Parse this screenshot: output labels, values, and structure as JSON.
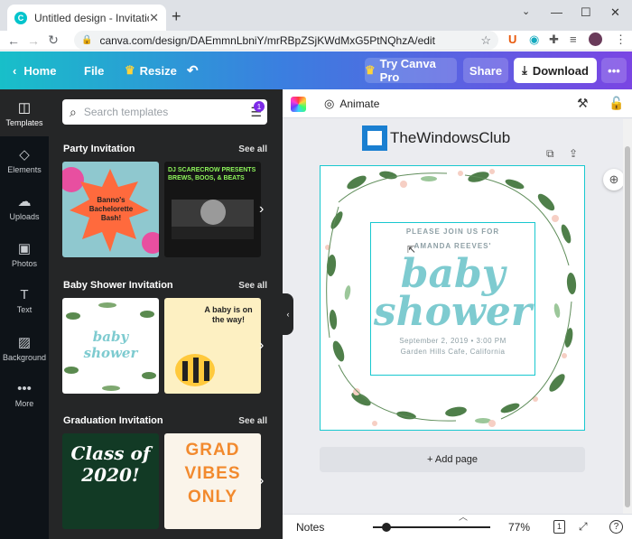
{
  "browser": {
    "tab_title": "Untitled design - Invitation (Squ…",
    "tab_favicon": "C",
    "url": "canva.com/design/DAEmmnLbniY/mrRBpZSjKWdMxG5PtNQhzA/edit"
  },
  "header": {
    "home": "Home",
    "file": "File",
    "resize": "Resize",
    "try_pro": "Try Canva Pro",
    "share": "Share",
    "download": "Download"
  },
  "rail": [
    {
      "label": "Templates",
      "icon": "templates-icon"
    },
    {
      "label": "Elements",
      "icon": "elements-icon"
    },
    {
      "label": "Uploads",
      "icon": "uploads-icon"
    },
    {
      "label": "Photos",
      "icon": "photos-icon"
    },
    {
      "label": "Text",
      "icon": "text-icon"
    },
    {
      "label": "Background",
      "icon": "background-icon"
    },
    {
      "label": "More",
      "icon": "more-icon"
    }
  ],
  "panel": {
    "search_placeholder": "Search templates",
    "filter_badge": "1",
    "see_all": "See all",
    "sections": [
      {
        "title": "Party Invitation",
        "thumbs": [
          {
            "text": "Banno's Bachelorette Bash!"
          },
          {
            "text": "DJ SCARECROW PRESENTS BREWS, BOOS, & BEATS"
          }
        ]
      },
      {
        "title": "Baby Shower Invitation",
        "thumbs": [
          {
            "text": "baby shower"
          },
          {
            "text": "A baby is on the way!"
          }
        ]
      },
      {
        "title": "Graduation Invitation",
        "thumbs": [
          {
            "text": "Class of 2020!"
          },
          {
            "text": "GRAD VIBES ONLY"
          }
        ]
      }
    ]
  },
  "canvas": {
    "animate": "Animate",
    "logo_text": "TheWindowsClub",
    "invite_line1": "PLEASE JOIN US FOR",
    "invite_line2": "AMANDA REEVES'",
    "title_line1": "baby",
    "title_line2": "shower",
    "date": "September 2, 2019  •  3:00 PM",
    "place": "Garden Hills Cafe, California",
    "add_page": "+ Add page"
  },
  "bottom": {
    "notes": "Notes",
    "zoom": "77%",
    "page_count": "1",
    "zoom_level": 0.77
  },
  "colors": {
    "accent": "#18c8cf",
    "brand_purple": "#7d2ae8",
    "invite_teal": "#7ecbd0",
    "leaf_green": "#4f7f4a",
    "panel_bg": "#252627"
  }
}
